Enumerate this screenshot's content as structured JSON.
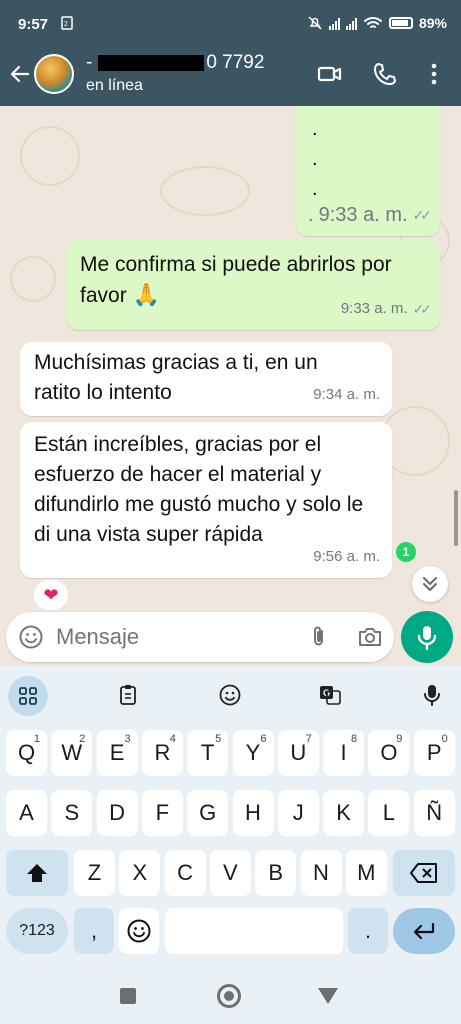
{
  "status_bar": {
    "time": "9:57",
    "sim_icon": "dual-sim-icon",
    "battery": "89%",
    "icons": [
      "mute-icon",
      "signal-icon",
      "signal-icon",
      "wifi-icon",
      "battery-icon"
    ]
  },
  "header": {
    "contact_name_suffix": "0 7792",
    "contact_name_prefix": "-",
    "status": "en línea",
    "actions": [
      "video-call-icon",
      "phone-icon",
      "more-options-icon"
    ]
  },
  "messages": [
    {
      "direction": "out",
      "lines": [
        ".",
        ".",
        ".",
        "."
      ],
      "time": "9:33 a. m."
    },
    {
      "direction": "out",
      "text": "Me confirma si puede abrirlos por favor",
      "emoji": "🙏",
      "time": "9:33 a. m."
    },
    {
      "direction": "in",
      "text": "Muchísimas gracias a ti, en un ratito lo intento",
      "time": "9:34 a. m."
    },
    {
      "direction": "in",
      "text": "Están increíbles, gracias por el esfuerzo de hacer el material y difundirlo me gustó mucho y solo le di una vista super rápida",
      "time": "9:56 a. m.",
      "reaction": "❤"
    }
  ],
  "unread_count": "1",
  "composer": {
    "placeholder": "Mensaje"
  },
  "keyboard": {
    "row1": [
      {
        "k": "Q",
        "s": "1"
      },
      {
        "k": "W",
        "s": "2"
      },
      {
        "k": "E",
        "s": "3"
      },
      {
        "k": "R",
        "s": "4"
      },
      {
        "k": "T",
        "s": "5"
      },
      {
        "k": "Y",
        "s": "6"
      },
      {
        "k": "U",
        "s": "7"
      },
      {
        "k": "I",
        "s": "8"
      },
      {
        "k": "O",
        "s": "9"
      },
      {
        "k": "P",
        "s": "0"
      }
    ],
    "row2": [
      "A",
      "S",
      "D",
      "F",
      "G",
      "H",
      "J",
      "K",
      "L",
      "Ñ"
    ],
    "row3": [
      "Z",
      "X",
      "C",
      "V",
      "B",
      "N",
      "M"
    ],
    "symbols_label": "?123",
    "comma": ",",
    "period": "."
  },
  "colors": {
    "header": "#3b5563",
    "outgoing_bubble": "#dcf8c6",
    "incoming_bubble": "#ffffff",
    "chat_background": "#efe7dd",
    "accent": "#00a884"
  }
}
